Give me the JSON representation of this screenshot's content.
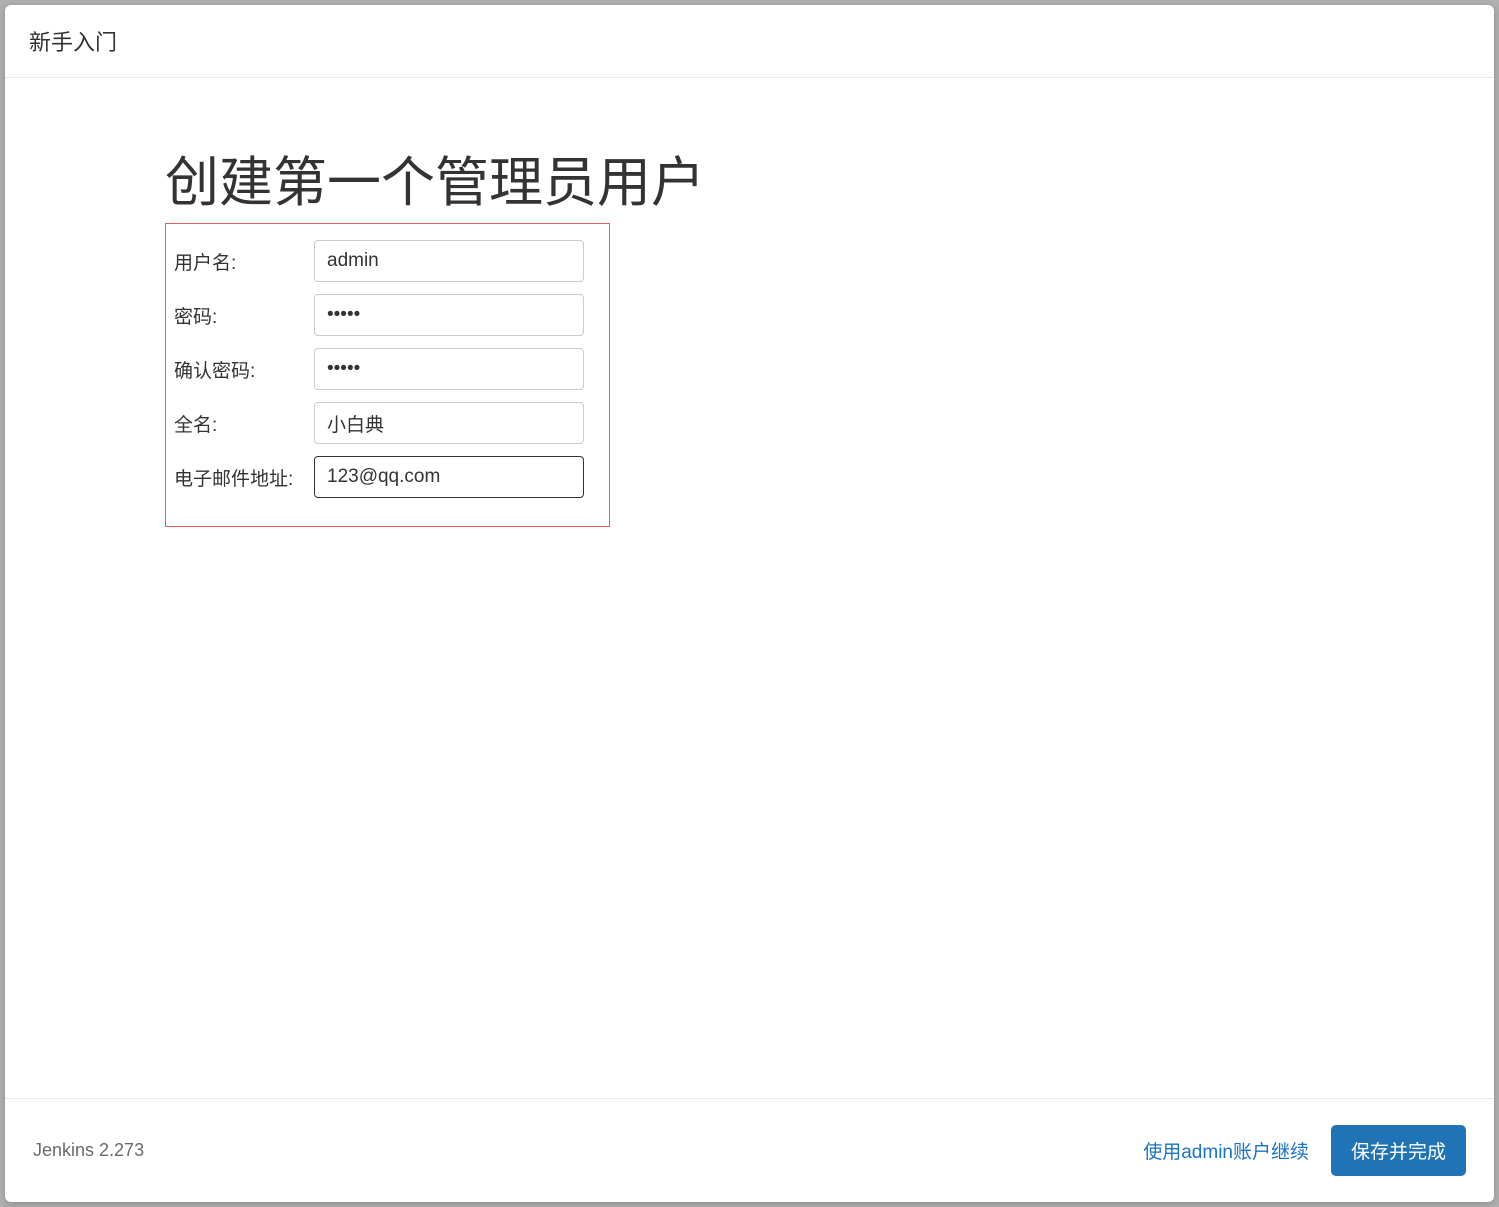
{
  "header": {
    "title": "新手入门"
  },
  "main": {
    "page_title": "创建第一个管理员用户",
    "form": {
      "username": {
        "label": "用户名:",
        "value": "admin"
      },
      "password": {
        "label": "密码:",
        "value": "•••••"
      },
      "confirm_password": {
        "label": "确认密码:",
        "value": "•••••"
      },
      "fullname": {
        "label": "全名:",
        "value": "小白典"
      },
      "email": {
        "label": "电子邮件地址:",
        "value": "123@qq.com"
      }
    }
  },
  "footer": {
    "version": "Jenkins 2.273",
    "continue_as_admin": "使用admin账户继续",
    "save_button": "保存并完成"
  }
}
